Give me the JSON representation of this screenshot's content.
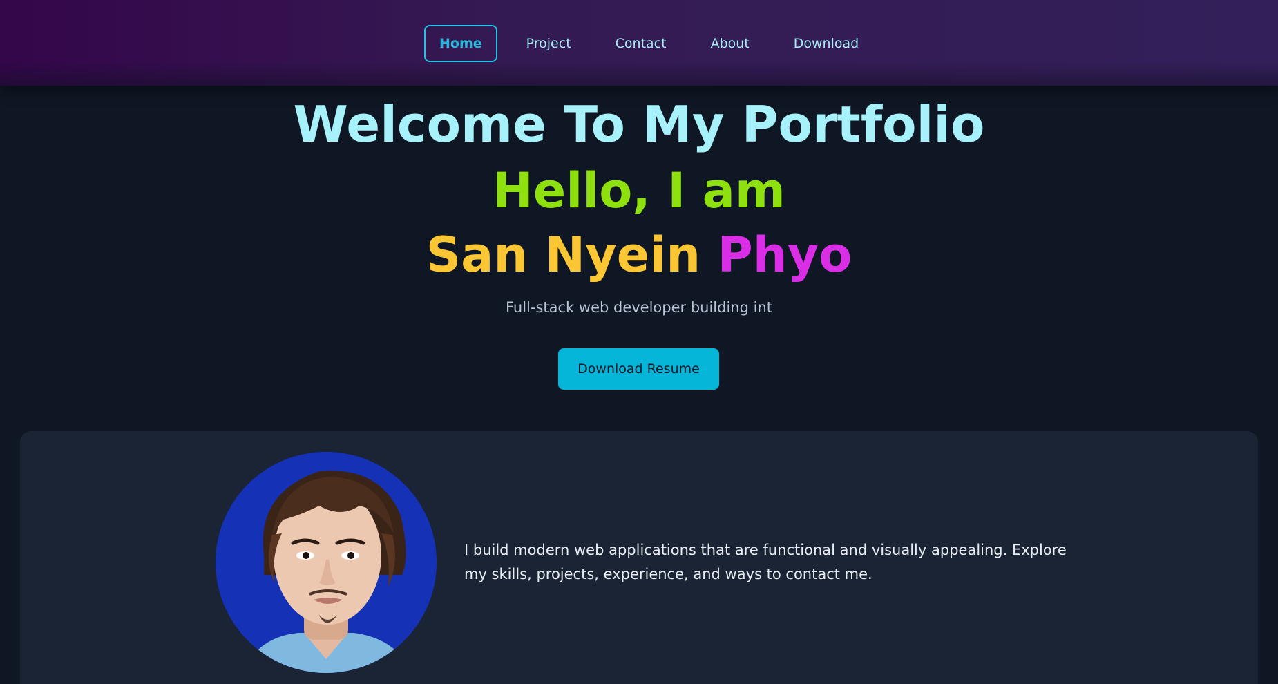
{
  "nav": {
    "items": [
      {
        "label": "Home",
        "active": true
      },
      {
        "label": "Project",
        "active": false
      },
      {
        "label": "Contact",
        "active": false
      },
      {
        "label": "About",
        "active": false
      },
      {
        "label": "Download",
        "active": false
      }
    ]
  },
  "hero": {
    "title": "Welcome To My Portfolio",
    "greeting": "Hello, I am",
    "name_first": "San Nyein",
    "name_last": "Phyo",
    "tagline": "Full-stack web developer building int",
    "resume_button": "Download Resume"
  },
  "about": {
    "text": "I build modern web applications that are functional and visually appealing. Explore my skills, projects, experience, and ways to contact me."
  },
  "colors": {
    "background": "#0f1724",
    "accent": "#06b6d8",
    "title": "#a6f1fa",
    "greeting": "#8ee00f",
    "name_first": "#fbc634",
    "name_last": "#d92ee6",
    "card": "#1b2434"
  }
}
